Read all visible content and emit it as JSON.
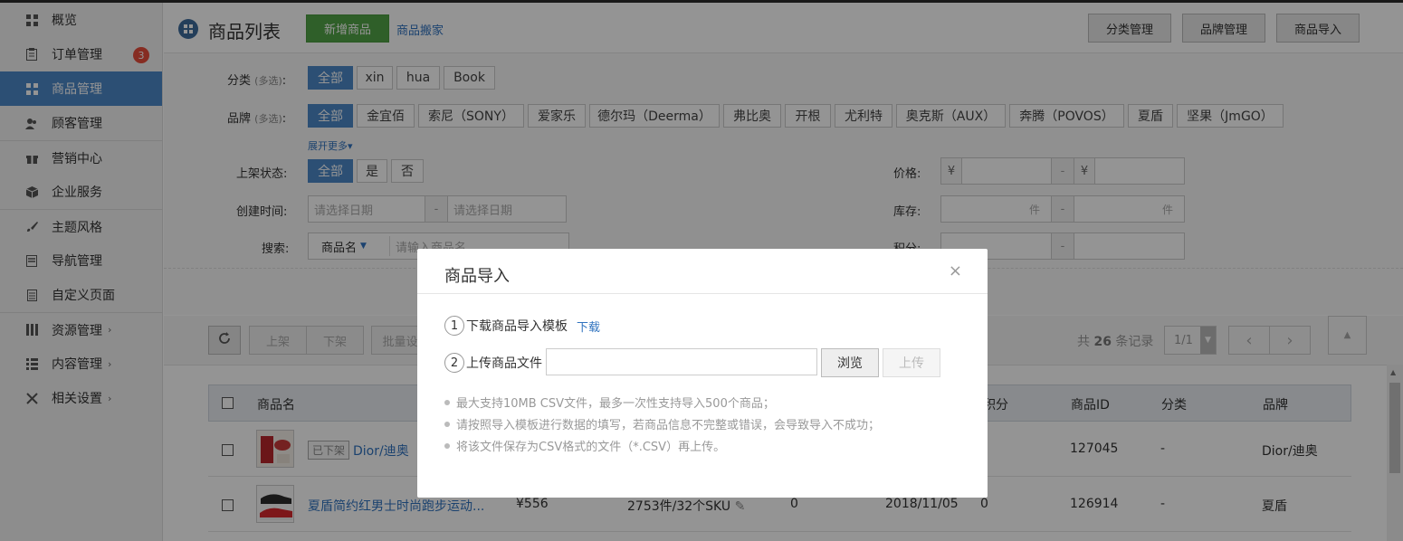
{
  "sidebar": {
    "items": [
      {
        "label": "概览",
        "icon": "dashboard-icon"
      },
      {
        "label": "订单管理",
        "icon": "clipboard-icon",
        "badge": "3"
      },
      {
        "label": "商品管理",
        "icon": "grid-icon",
        "active": true
      },
      {
        "label": "顾客管理",
        "icon": "users-icon"
      },
      {
        "label": "营销中心",
        "icon": "gift-icon"
      },
      {
        "label": "企业服务",
        "icon": "cube-icon"
      },
      {
        "label": "主题风格",
        "icon": "brush-icon"
      },
      {
        "label": "导航管理",
        "icon": "list-icon"
      },
      {
        "label": "自定义页面",
        "icon": "page-icon"
      },
      {
        "label": "资源管理",
        "icon": "columns-icon",
        "arrow": "›"
      },
      {
        "label": "内容管理",
        "icon": "content-icon",
        "arrow": "›"
      },
      {
        "label": "相关设置",
        "icon": "tools-icon",
        "arrow": "›"
      }
    ]
  },
  "header": {
    "title": "商品列表",
    "add_button": "新增商品",
    "move_link": "商品搬家",
    "category_mgmt": "分类管理",
    "brand_mgmt": "品牌管理",
    "import_button": "商品导入"
  },
  "filters": {
    "category_label": "分类",
    "optional_hint": "(多选)",
    "label_suffix": ":",
    "categories": [
      "全部",
      "xin",
      "hua",
      "Book"
    ],
    "brand_label": "品牌",
    "brands": [
      "全部",
      "金宜佰",
      "索尼（SONY）",
      "爱家乐",
      "德尔玛（Deerma）",
      "弗比奥",
      "开根",
      "尤利特",
      "奥克斯（AUX）",
      "奔腾（POVOS）",
      "夏盾",
      "坚果（JmGO）"
    ],
    "expand_more": "展开更多▾",
    "shelf_label": "上架状态:",
    "shelf_options": [
      "全部",
      "是",
      "否"
    ],
    "created_label": "创建时间:",
    "date_placeholder": "请选择日期",
    "dash": "-",
    "search_label": "搜索:",
    "search_type": "商品名",
    "search_placeholder": "请输入商品名",
    "price_label": "价格:",
    "yen": "¥",
    "stock_label": "库存:",
    "stock_unit": "件",
    "points_label": "积分:"
  },
  "toolbar": {
    "on_shelf": "上架",
    "off_shelf": "下架",
    "batch": "批量设",
    "total_prefix": "共",
    "total_count": "26",
    "total_suffix": "条记录",
    "page": "1/1",
    "prev": "‹",
    "next": "›",
    "to_top": "▲"
  },
  "table": {
    "headers": {
      "name": "商品名",
      "points": "积分",
      "id": "商品ID",
      "category": "分类",
      "brand": "品牌"
    },
    "rows": [
      {
        "status": "已下架",
        "name": "Dior/迪奥",
        "id": "127045",
        "category": "-",
        "brand": "Dior/迪奥"
      },
      {
        "name": "夏盾简约红男士时尚跑步运动...",
        "price": "¥556",
        "stock": "2753件/32个SKU",
        "sales": "0",
        "date": "2018/11/05",
        "points": "0",
        "id": "126914",
        "category": "-",
        "brand": "夏盾"
      }
    ]
  },
  "modal": {
    "title": "商品导入",
    "close": "×",
    "step1_num": "1",
    "step1_text": "下载商品导入模板",
    "download_link": "下载",
    "step2_num": "2",
    "step2_text": "上传商品文件",
    "browse": "浏览",
    "upload": "上传",
    "notes": [
      "最大支持10MB CSV文件，最多一次性支持导入500个商品；",
      "请按照导入模板进行数据的填写，若商品信息不完整或错误，会导致导入不成功；",
      "将该文件保存为CSV格式的文件（*.CSV）再上传。"
    ]
  },
  "colors": {
    "accent": "#4c88c9",
    "green": "#52a447",
    "link": "#3073bf",
    "badge": "#e74c3c"
  }
}
